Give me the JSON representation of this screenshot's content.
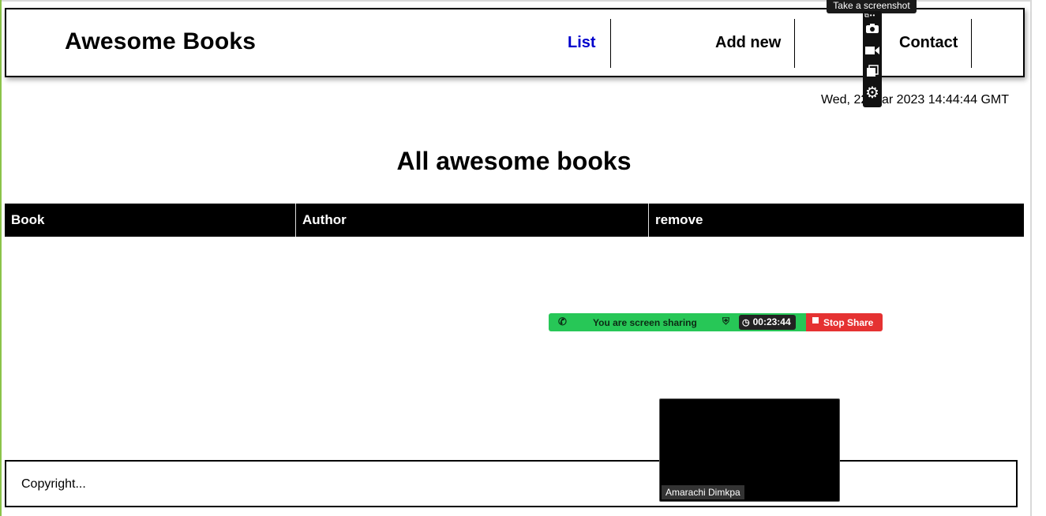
{
  "app": {
    "brand": "Awesome Books",
    "nav": [
      {
        "label": "List",
        "active": true
      },
      {
        "label": "Add new",
        "active": false
      },
      {
        "label": "Contact",
        "active": false
      }
    ],
    "date": "Wed, 22 Mar 2023 14:44:44 GMT"
  },
  "main": {
    "title": "All awesome books",
    "table_headers": [
      "Book",
      "Author",
      "remove"
    ],
    "rows": []
  },
  "footer": {
    "text": "Copyright..."
  },
  "overlay": {
    "tooltip": "Take a screenshot",
    "share_message": "You are screen sharing",
    "timer": "00:23:44",
    "stop_label": "Stop Share",
    "participant_name": "Amarachi Dimkpa",
    "toolbar_icons": [
      "camera-icon",
      "video-icon",
      "window-icon",
      "gear-icon"
    ]
  },
  "colors": {
    "active_link": "#0000cc",
    "share_green": "#27c757",
    "stop_red": "#e53232"
  }
}
